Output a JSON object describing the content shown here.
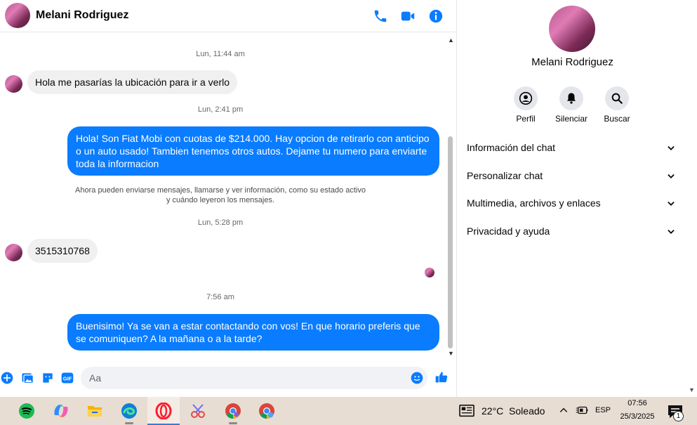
{
  "header": {
    "contact_name": "Melani Rodriguez",
    "icons": [
      "phone-icon",
      "video-camera-icon",
      "info-icon"
    ],
    "accent_color": "#0a7cff"
  },
  "messages": {
    "timestamp_1": "Lun, 11:44 am",
    "incoming_1": "Hola me pasarías la ubicación para ir a verlo",
    "timestamp_2": "Lun, 2:41 pm",
    "outgoing_1": "Hola! Son Fiat Mobi con cuotas de $214.000. Hay opcion de retirarlo con anticipo o un auto usado! Tambien tenemos otros autos. Dejame tu numero para enviarte toda la informacion",
    "system_line_1": "Ahora pueden enviarse mensajes, llamarse y ver información, como su estado activo",
    "system_line_2": "y cuándo leyeron los mensajes.",
    "timestamp_3": "Lun, 5:28 pm",
    "incoming_2": "3515310768",
    "timestamp_4": "7:56 am",
    "outgoing_2": "Buenisimo! Ya se van a estar contactando con vos! En que horario preferis que se comuniquen? A la mañana o a la tarde?"
  },
  "composer": {
    "placeholder": "Aa",
    "icons": [
      "plus-icon",
      "image-icon",
      "sticker-icon",
      "gif-icon",
      "emoji-icon",
      "thumbs-up-icon"
    ],
    "gif_label": "GIF"
  },
  "info_pane": {
    "name": "Melani Rodriguez",
    "actions": [
      {
        "label": "Perfil",
        "icon": "profile-icon"
      },
      {
        "label": "Silenciar",
        "icon": "bell-icon"
      },
      {
        "label": "Buscar",
        "icon": "search-icon"
      }
    ],
    "sections": [
      "Información del chat",
      "Personalizar chat",
      "Multimedia, archivos y enlaces",
      "Privacidad y ayuda"
    ]
  },
  "taskbar": {
    "apps": [
      "spotify-icon",
      "copilot-icon",
      "file-explorer-icon",
      "edge-icon",
      "opera-icon",
      "snipping-tool-icon",
      "chrome-icon",
      "chrome-profile-icon"
    ],
    "weather": "22°C  Soleado",
    "language": "ESP",
    "time": "07:56",
    "date": "25/3/2025",
    "notification_count": "1"
  }
}
